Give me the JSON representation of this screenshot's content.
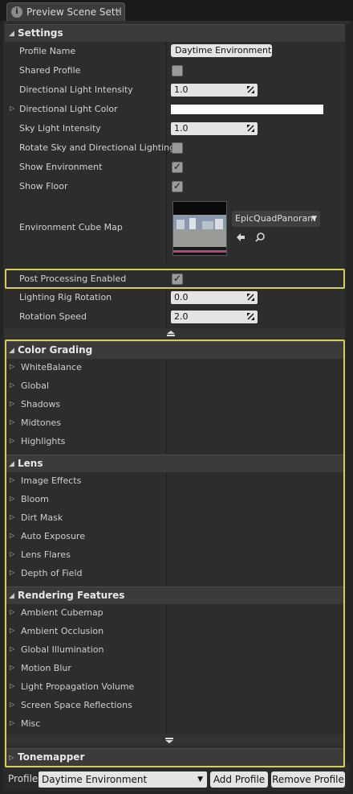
{
  "tab": {
    "title": "Preview Scene Setti",
    "close": "✕"
  },
  "settings": {
    "header": "Settings",
    "profile_name_label": "Profile Name",
    "profile_name_value": "Daytime Environment",
    "shared_profile_label": "Shared Profile",
    "shared_profile_checked": false,
    "dir_light_intensity_label": "Directional Light Intensity",
    "dir_light_intensity_value": "1.0",
    "dir_light_color_label": "Directional Light Color",
    "dir_light_color": "#ffffff",
    "sky_light_intensity_label": "Sky Light Intensity",
    "sky_light_intensity_value": "1.0",
    "rotate_sky_label": "Rotate Sky and Directional Lighting",
    "rotate_sky_checked": false,
    "show_environment_label": "Show Environment",
    "show_environment_checked": true,
    "show_floor_label": "Show Floor",
    "show_floor_checked": true,
    "env_cube_map_label": "Environment Cube Map",
    "env_cube_map_asset": "EpicQuadPanoram",
    "post_processing_label": "Post Processing Enabled",
    "post_processing_checked": true,
    "rig_rotation_label": "Lighting Rig Rotation",
    "rig_rotation_value": "0.0",
    "rotation_speed_label": "Rotation Speed",
    "rotation_speed_value": "2.0"
  },
  "color_grading": {
    "header": "Color Grading",
    "items": [
      "WhiteBalance",
      "Global",
      "Shadows",
      "Midtones",
      "Highlights"
    ]
  },
  "lens": {
    "header": "Lens",
    "items": [
      "Image Effects",
      "Bloom",
      "Dirt Mask",
      "Auto Exposure",
      "Lens Flares",
      "Depth of Field"
    ]
  },
  "rendering_features": {
    "header": "Rendering Features",
    "items": [
      "Ambient Cubemap",
      "Ambient Occlusion",
      "Global Illumination",
      "Motion Blur",
      "Light Propagation Volume",
      "Screen Space Reflections",
      "Misc"
    ]
  },
  "tonemapper": {
    "header": "Tonemapper"
  },
  "bottom": {
    "profile_label": "Profile",
    "profile_value": "Daytime Environment",
    "add_profile": "Add Profile",
    "remove_profile": "Remove Profile"
  },
  "colors": {
    "highlight": "#d7cf55",
    "panel": "#2d2d2d",
    "header": "#3b3b3b"
  },
  "icons": [
    "info-icon",
    "close-icon",
    "spinner-icon",
    "checkmark-icon",
    "arrow-left-icon",
    "search-icon",
    "expand-arrow-icon",
    "collapse-arrow-icon",
    "dropdown-icon"
  ]
}
